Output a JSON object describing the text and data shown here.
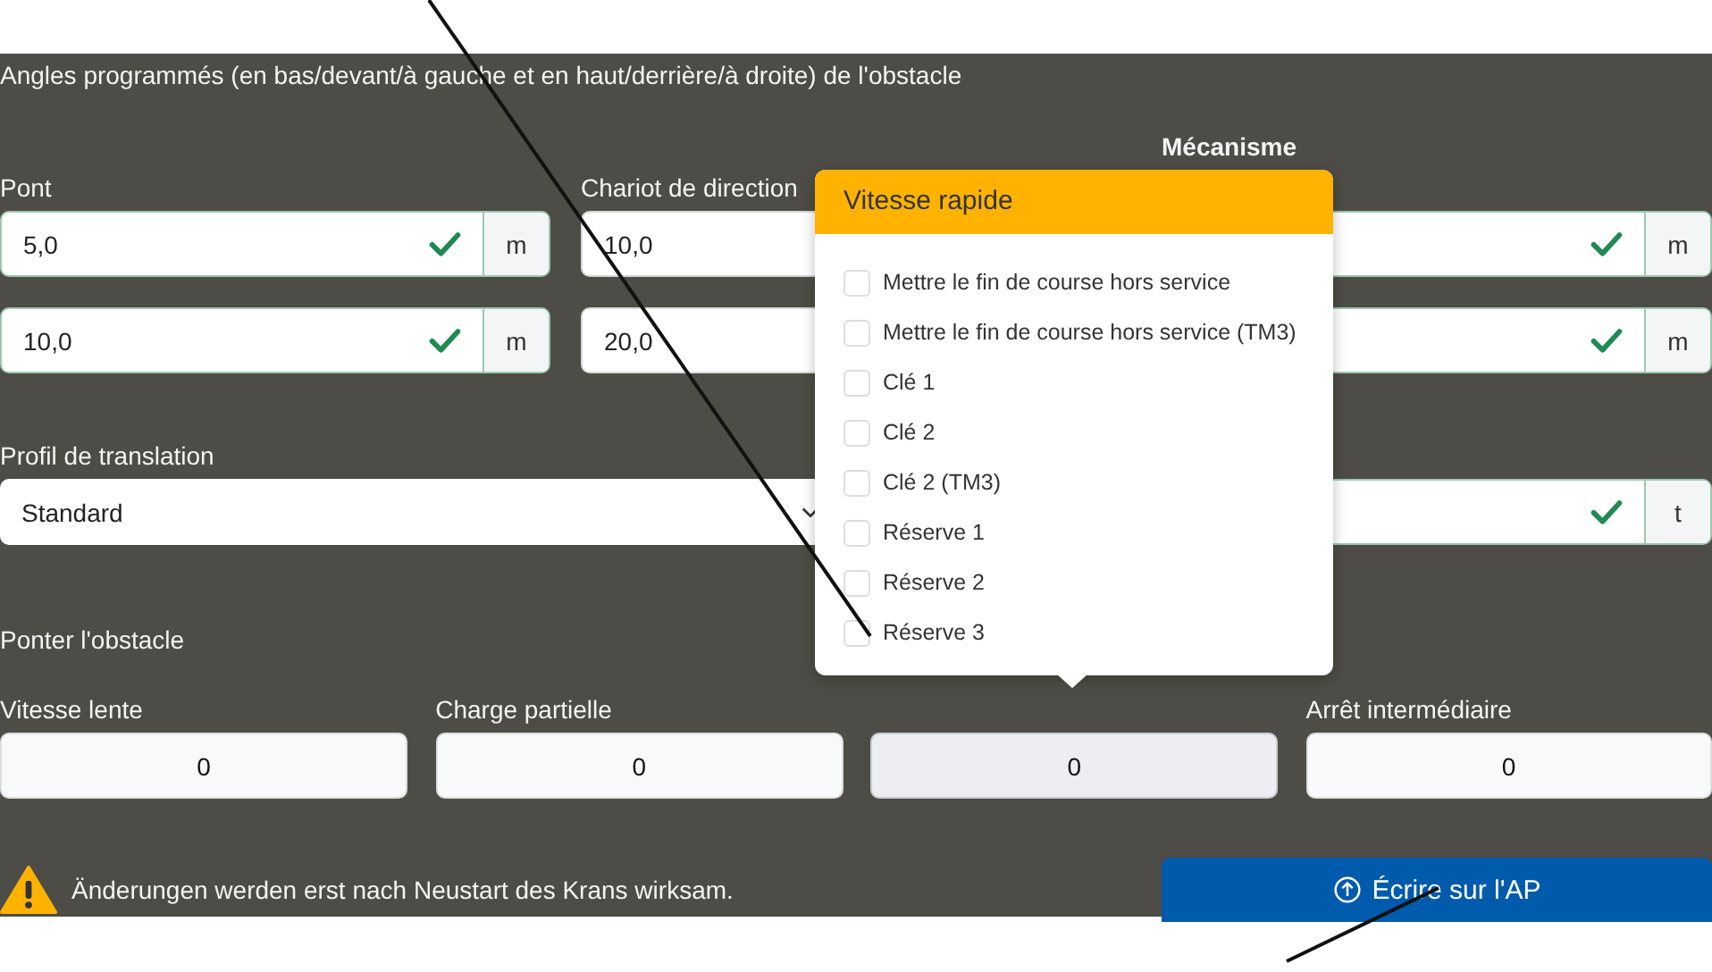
{
  "section_title": "Angles programmés (en bas/devant/à gauche et en haut/derrière/à droite) de l'obstacle",
  "mechanism_heading": "Mécanisme",
  "position_groups": [
    {
      "label": "Pont",
      "fields": [
        {
          "value": "5,0",
          "valid": true,
          "unit": "m"
        },
        {
          "value": "10,0",
          "valid": true,
          "unit": "m"
        }
      ]
    },
    {
      "label": "Chariot de direction",
      "fields": [
        {
          "value": "10,0"
        },
        {
          "value": "20,0"
        }
      ]
    },
    {
      "fields": [
        {
          "valid": true,
          "unit": "m"
        },
        {
          "valid": true,
          "unit": "m"
        }
      ]
    }
  ],
  "profile": {
    "label": "Profil de translation",
    "value": "Standard"
  },
  "load_field": {
    "valid": true,
    "unit": "t"
  },
  "bridge_heading": "Ponter l'obstacle",
  "bridge_fields": [
    {
      "label": "Vitesse lente",
      "value": "0",
      "selected": false
    },
    {
      "label": "Charge partielle",
      "value": "0",
      "selected": false
    },
    {
      "value": "0",
      "selected": true
    },
    {
      "label": "Arrêt intermédiaire",
      "value": "0",
      "selected": false
    }
  ],
  "popup": {
    "title": "Vitesse rapide",
    "options": [
      {
        "label": "Mettre le fin de course hors service",
        "checked": false
      },
      {
        "label": "Mettre le fin de course hors service (TM3)",
        "checked": false
      },
      {
        "label": "Clé 1",
        "checked": false
      },
      {
        "label": "Clé 2",
        "checked": false
      },
      {
        "label": "Clé 2 (TM3)",
        "checked": false
      },
      {
        "label": "Réserve 1",
        "checked": false
      },
      {
        "label": "Réserve 2",
        "checked": false
      },
      {
        "label": "Réserve 3",
        "checked": false
      }
    ]
  },
  "warning": "Änderungen werden erst nach Neustart des Krans wirksam.",
  "write_button": "Écrire sur l'AP"
}
